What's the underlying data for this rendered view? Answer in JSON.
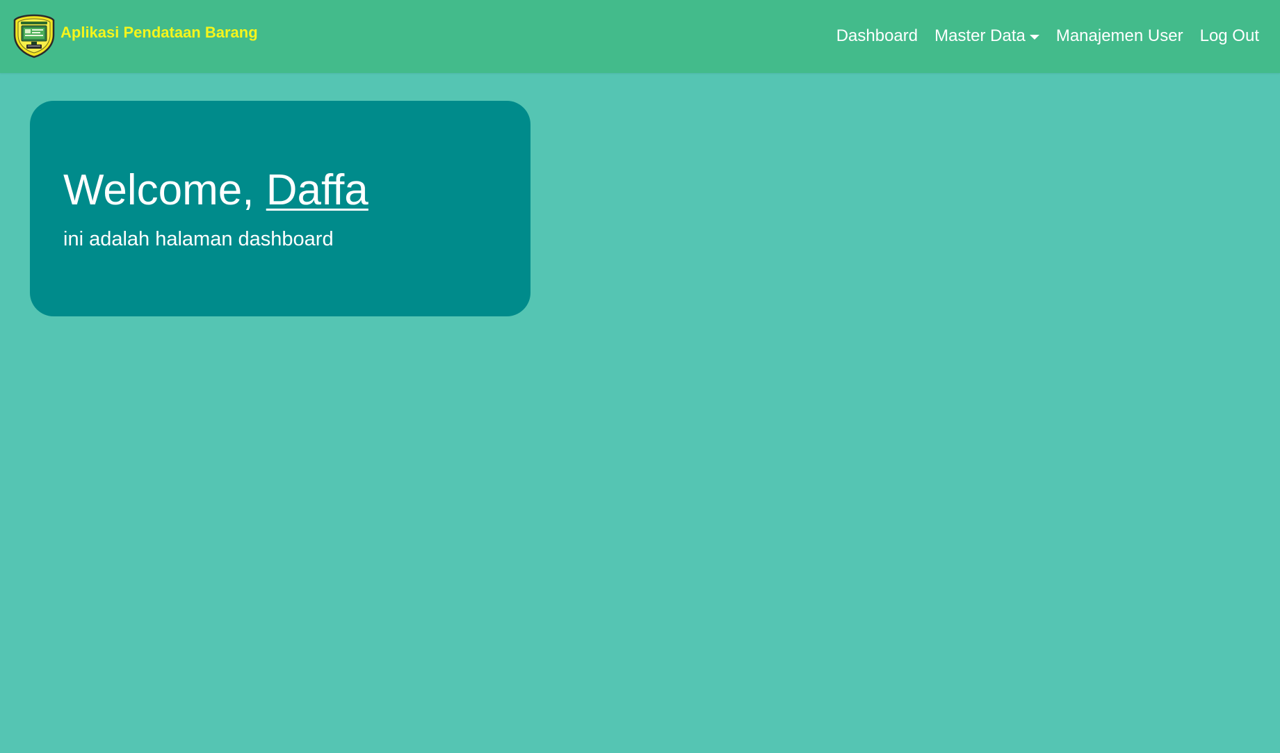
{
  "app": {
    "title": "Aplikasi Pendataan Barang",
    "logo_icon": "shield-emblem-icon"
  },
  "nav": {
    "items": [
      {
        "label": "Dashboard"
      },
      {
        "label": "Master Data",
        "has_dropdown": true
      },
      {
        "label": "Manajemen User"
      },
      {
        "label": "Log Out"
      }
    ]
  },
  "welcome": {
    "greeting": "Welcome, ",
    "user_name": "Daffa",
    "subtitle": "ini adalah halaman dashboard"
  },
  "colors": {
    "navbar_bg": "#43bb8b",
    "page_bg": "#55c5b3",
    "card_bg": "#008b8b",
    "brand_text": "#f5f51c",
    "nav_text": "#ffffff"
  }
}
